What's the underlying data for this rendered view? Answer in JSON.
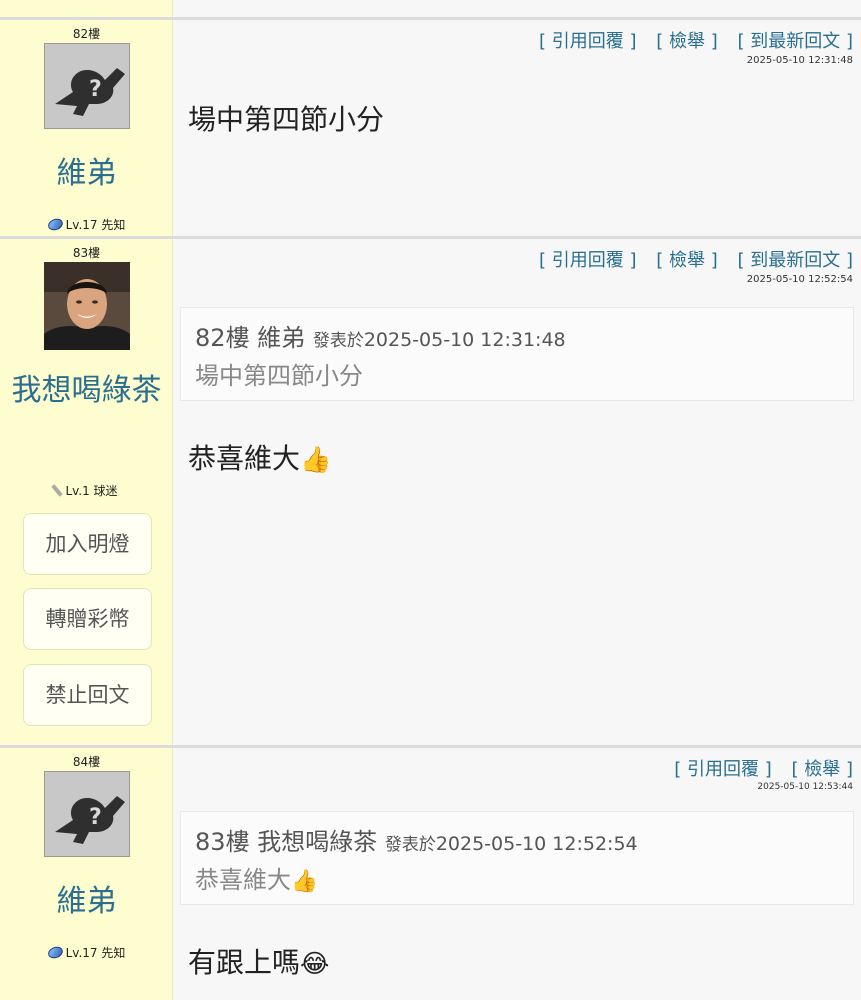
{
  "actions": {
    "quote_reply": "[ 引用回覆 ]",
    "report": "[ 檢舉 ]",
    "latest_reply": "[ 到最新回文 ]"
  },
  "posts": [
    {
      "floor": "82樓",
      "username": "維弟",
      "level": "Lv.17 先知",
      "timestamp": "2025-05-10 12:31:48",
      "body": "場中第四節小分"
    },
    {
      "floor": "83樓",
      "username": "我想喝綠茶",
      "level": "Lv.1 球迷",
      "timestamp": "2025-05-10 12:52:54",
      "quote": {
        "floor": "82樓",
        "author": "維弟",
        "posted_label": "發表於",
        "time": "2025-05-10 12:31:48",
        "text": "場中第四節小分"
      },
      "body": "恭喜維大",
      "body_emoji": "👍",
      "buttons": [
        "加入明燈",
        "轉贈彩幣",
        "禁止回文"
      ]
    },
    {
      "floor": "84樓",
      "username": "維弟",
      "level": "Lv.17 先知",
      "timestamp": "2025-05-10 12:53:44",
      "quote": {
        "floor": "83樓",
        "author": "我想喝綠茶",
        "posted_label": "發表於",
        "time": "2025-05-10 12:52:54",
        "text": "恭喜維大",
        "text_emoji": "👍"
      },
      "body": "有跟上嗎",
      "body_emoji": "😂"
    }
  ]
}
